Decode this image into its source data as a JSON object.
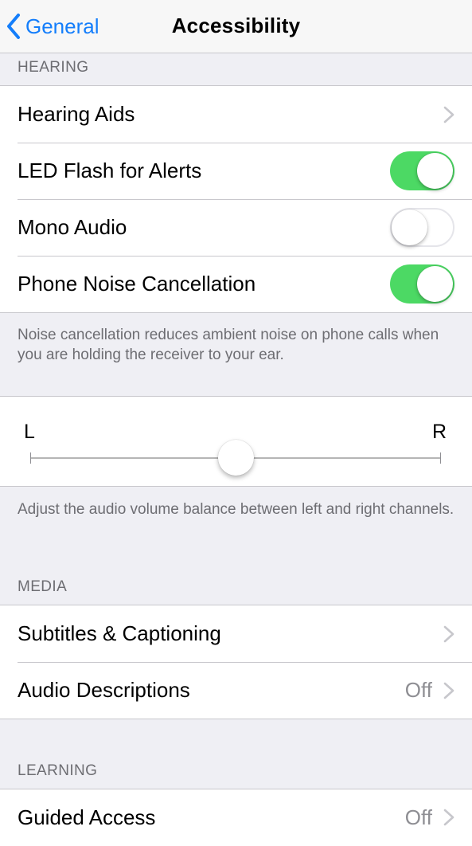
{
  "navbar": {
    "back_label": "General",
    "title": "Accessibility"
  },
  "hearing": {
    "header": "HEARING",
    "hearing_aids": "Hearing Aids",
    "led_flash": {
      "label": "LED Flash for Alerts",
      "on": true
    },
    "mono_audio": {
      "label": "Mono Audio",
      "on": false
    },
    "noise_cancel": {
      "label": "Phone Noise Cancellation",
      "on": true
    },
    "noise_footer": "Noise cancellation reduces ambient noise on phone calls when you are holding the receiver to your ear."
  },
  "balance": {
    "left_label": "L",
    "right_label": "R",
    "value": 0.5,
    "footer": "Adjust the audio volume balance between left and right channels."
  },
  "media": {
    "header": "MEDIA",
    "subtitles": "Subtitles & Captioning",
    "audio_descriptions": {
      "label": "Audio Descriptions",
      "value": "Off"
    }
  },
  "learning": {
    "header": "LEARNING",
    "guided_access": {
      "label": "Guided Access",
      "value": "Off"
    }
  },
  "colors": {
    "accent": "#147efb",
    "toggle_on": "#4cd964"
  }
}
